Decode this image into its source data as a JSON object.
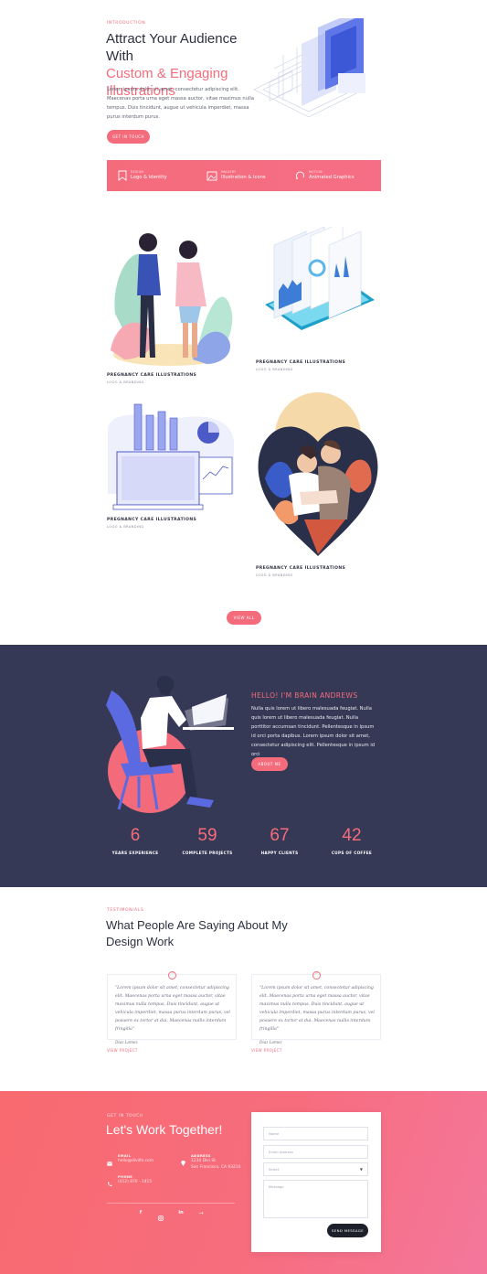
{
  "intro": {
    "eyebrow": "INTRODUCTION",
    "title_line1": "Attract Your Audience With",
    "title_accent1": "Custom & Engaging",
    "title_accent2": "Illustrations",
    "body": "Lorem ipsum dolor sit amet, consectetur adipiscing elit. Maecenas porta urna eget massa auctor, vitae maximus nulla tempus. Duis tincidunt, augue ut vehicula imperdiet, massa purus interdum purus.",
    "button": "GET IN TOUCH"
  },
  "services": [
    {
      "label": "DESIGN",
      "name": "Logo & Identity",
      "icon": "bookmark-icon"
    },
    {
      "label": "IMAGERY",
      "name": "Illustration & Icons",
      "icon": "image-icon"
    },
    {
      "label": "MOTION",
      "name": "Animated Graphics",
      "icon": "motion-icon"
    }
  ],
  "portfolio": {
    "items": [
      {
        "title": "PREGNANCY CARE ILLUSTRATIONS",
        "subtitle": "LOGO & BRANDING"
      },
      {
        "title": "PREGNANCY CARE ILLUSTRATIONS",
        "subtitle": "LOGO & BRANDING"
      },
      {
        "title": "PREGNANCY CARE ILLUSTRATIONS",
        "subtitle": "LOGO & BRANDING"
      },
      {
        "title": "PREGNANCY CARE ILLUSTRATIONS",
        "subtitle": "LOGO & BRANDING"
      }
    ],
    "button": "VIEW ALL"
  },
  "about": {
    "heading": "HELLO! I'M BRAIN ANDREWS",
    "body": "Nulla quis lorem ut libero malesuada feugiat. Nulla quis lorem ut libero malesuada feugiat. Nulla porttitor accumsan tincidunt. Pellentesque in ipsum id orci porta dapibus. Lorem ipsum dolor sit amet, consectetur adipiscing elit. Pellentesque in ipsum id orci",
    "button": "ABOUT ME",
    "stats": [
      {
        "value": "6",
        "label": "YEARS EXPERIENCE"
      },
      {
        "value": "59",
        "label": "COMPLETE PROJECTS"
      },
      {
        "value": "67",
        "label": "HAPPY CLIENTS"
      },
      {
        "value": "42",
        "label": "CUPS OF COFFEE"
      }
    ]
  },
  "testimonials": {
    "eyebrow": "TESTIMONIALS",
    "title_line1": "What People Are Saying About My",
    "title_line2": "Design Work",
    "items": [
      {
        "quote": "\"Lorem ipsum dolor sit amet, consectetur adipiscing elit. Maecenas porta urna eget massa auctor, vitae maximus nulla tempus. Duis tincidunt, augue ut vehicula imperdiet, massa purus interdum purus, vel posuere ex tortor at dui. Maecenas nullis interdum fringilla\"",
        "name": "Diaz Lomez",
        "link": "VIEW PROJECT"
      },
      {
        "quote": "\"Lorem ipsum dolor sit amet, consectetur adipiscing elit. Maecenas porta urna eget massa auctor, vitae maximus nulla tempus. Duis tincidunt, augue ut vehicula imperdiet, massa purus interdum purus, vel posuere ex tortor at dui. Maecenas nullis interdum fringilla\"",
        "name": "Diaz Lomez",
        "link": "VIEW PROJECT"
      }
    ]
  },
  "contact": {
    "eyebrow": "GET IN TOUCH",
    "title": "Let's Work Together!",
    "email_label": "EMAIL",
    "email_value": "hello@divilfo.com",
    "address_label": "ADDRESS",
    "address_value1": "1234 Divi St.",
    "address_value2": "San Francisco, CA 93210",
    "phone_label": "PHONE",
    "phone_value": "(412) 876 - 1415",
    "social_icons": [
      "facebook-icon",
      "instagram-icon",
      "linkedin-icon",
      "arrow-icon"
    ],
    "form": {
      "name_placeholder": "Name",
      "email_placeholder": "Email Address",
      "select_value": "Select",
      "message_placeholder": "Message",
      "submit": "SEND MESSAGE"
    }
  },
  "colors": {
    "accent": "#f46c7c",
    "navy": "#353955",
    "ink": "#2d3040"
  }
}
